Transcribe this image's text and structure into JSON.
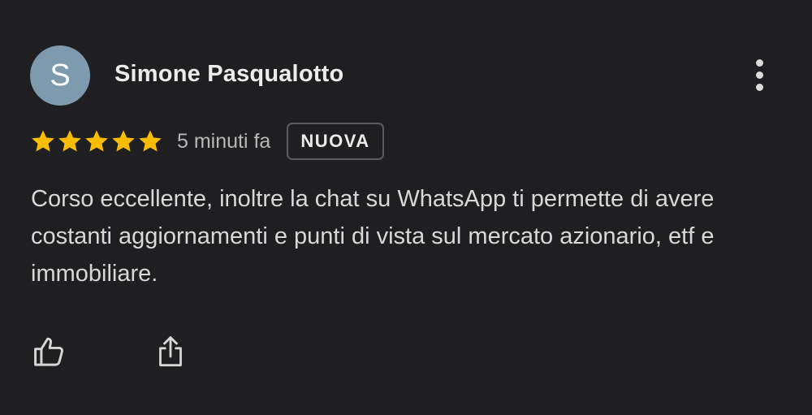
{
  "review": {
    "author": {
      "name": "Simone Pasqualotto",
      "avatar_initial": "S",
      "avatar_color": "#7e9aae"
    },
    "rating": 5,
    "max_rating": 5,
    "star_color": "#fbbc04",
    "time_ago": "5 minuti fa",
    "badge": "NUOVA",
    "text": "Corso eccellente, inoltre la chat su WhatsApp ti permette di avere costanti aggiornamenti e punti di vista sul mercato azionario, etf e immobiliare."
  },
  "actions": {
    "like_icon": "thumb-up-icon",
    "share_icon": "share-icon",
    "more_icon": "more-vert-icon"
  }
}
